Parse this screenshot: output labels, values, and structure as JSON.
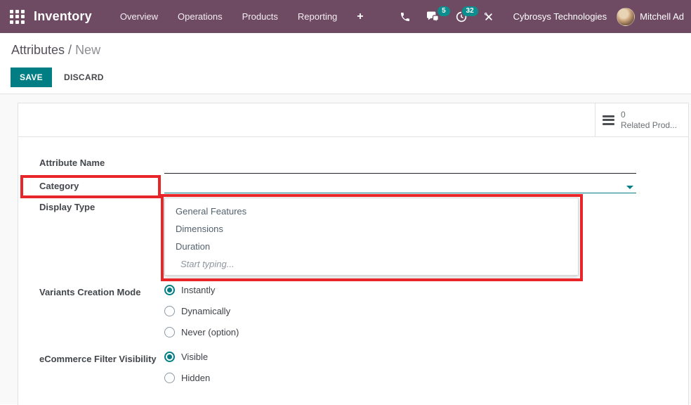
{
  "navbar": {
    "app_name": "Inventory",
    "menu": [
      "Overview",
      "Operations",
      "Products",
      "Reporting"
    ],
    "plus": "+",
    "messages_badge": "5",
    "activities_badge": "32",
    "company": "Cybrosys Technologies",
    "user_name": "Mitchell Ad"
  },
  "breadcrumb": {
    "parent": "Attributes",
    "separator": " / ",
    "current": "New"
  },
  "toolbar": {
    "save": "SAVE",
    "discard": "DISCARD"
  },
  "stat_button": {
    "value": "0",
    "label": "Related Prod..."
  },
  "form": {
    "attribute_name_label": "Attribute Name",
    "category_label": "Category",
    "display_type_label": "Display Type",
    "variants_label": "Variants Creation Mode",
    "variants_options": [
      {
        "label": "Instantly",
        "selected": true
      },
      {
        "label": "Dynamically",
        "selected": false
      },
      {
        "label": "Never (option)",
        "selected": false
      }
    ],
    "ecommerce_label": "eCommerce Filter Visibility",
    "ecommerce_options": [
      {
        "label": "Visible",
        "selected": true
      },
      {
        "label": "Hidden",
        "selected": false
      }
    ],
    "category_dropdown": {
      "items": [
        "General Features",
        "Dimensions",
        "Duration"
      ],
      "hint": "Start typing..."
    }
  },
  "colors": {
    "navbar_bg": "#6e4a63",
    "accent_teal": "#017e84",
    "badge_teal": "#0c8e8e",
    "highlight_red": "#e8262a"
  }
}
